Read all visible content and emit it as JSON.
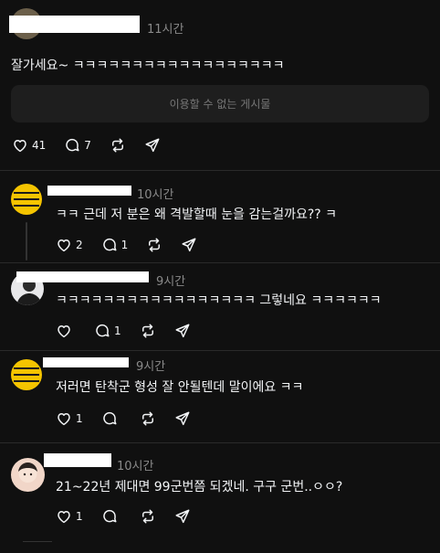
{
  "post": {
    "time": "11시간",
    "text": "잘가세요~ ㅋㅋㅋㅋㅋㅋㅋㅋㅋㅋㅋㅋㅋㅋㅋㅋㅋㅋ",
    "hidden_label": "이용할 수 없는 게시물",
    "likes": "41",
    "comments": "7"
  },
  "replies": [
    {
      "time": "10시간",
      "text": "ㅋㅋ 근데 저 분은 왜 격발할때 눈을 감는걸까요?? ㅋ",
      "likes": "2",
      "comments": "1"
    },
    {
      "time": "9시간",
      "text": "ㅋㅋㅋㅋㅋㅋㅋㅋㅋㅋㅋㅋㅋㅋㅋㅋㅋ 그렇네요 ㅋㅋㅋㅋㅋㅋ",
      "likes": "",
      "comments": "1"
    },
    {
      "time": "9시간",
      "text": "저러면 탄착군 형성 잘 안될텐데 말이에요 ㅋㅋ",
      "likes": "1",
      "comments": ""
    },
    {
      "time": "10시간",
      "text": "21~22년 제대면 99군번쯤 되겠네. 구구 군번..ㅇㅇ?",
      "likes": "1",
      "comments": ""
    }
  ],
  "icons": [
    "heart-icon",
    "comment-icon",
    "repost-icon",
    "share-icon"
  ]
}
